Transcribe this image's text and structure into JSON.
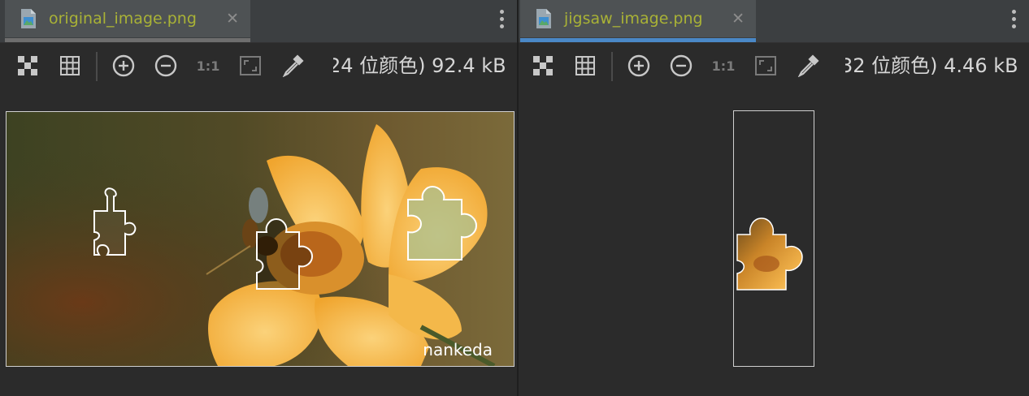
{
  "panes": [
    {
      "tab_title": "original_image.png",
      "close_glyph": "✕",
      "info": "24 位颜色) 92.4 kB",
      "zoom_1to1": "1:1",
      "watermark": "nankeda"
    },
    {
      "tab_title": "jigsaw_image.png",
      "close_glyph": "✕",
      "info": "32 位颜色) 4.46 kB",
      "zoom_1to1": "1:1"
    }
  ],
  "toolbar_icons": [
    "chessboard-icon",
    "grid-icon",
    "zoom-in-icon",
    "zoom-out-icon",
    "actual-size-icon",
    "fit-to-window-icon",
    "color-picker-icon"
  ],
  "colors": {
    "background": "#2b2b2b",
    "tab_active_underline": "#4a88c7",
    "tab_title": "#a9b236"
  }
}
